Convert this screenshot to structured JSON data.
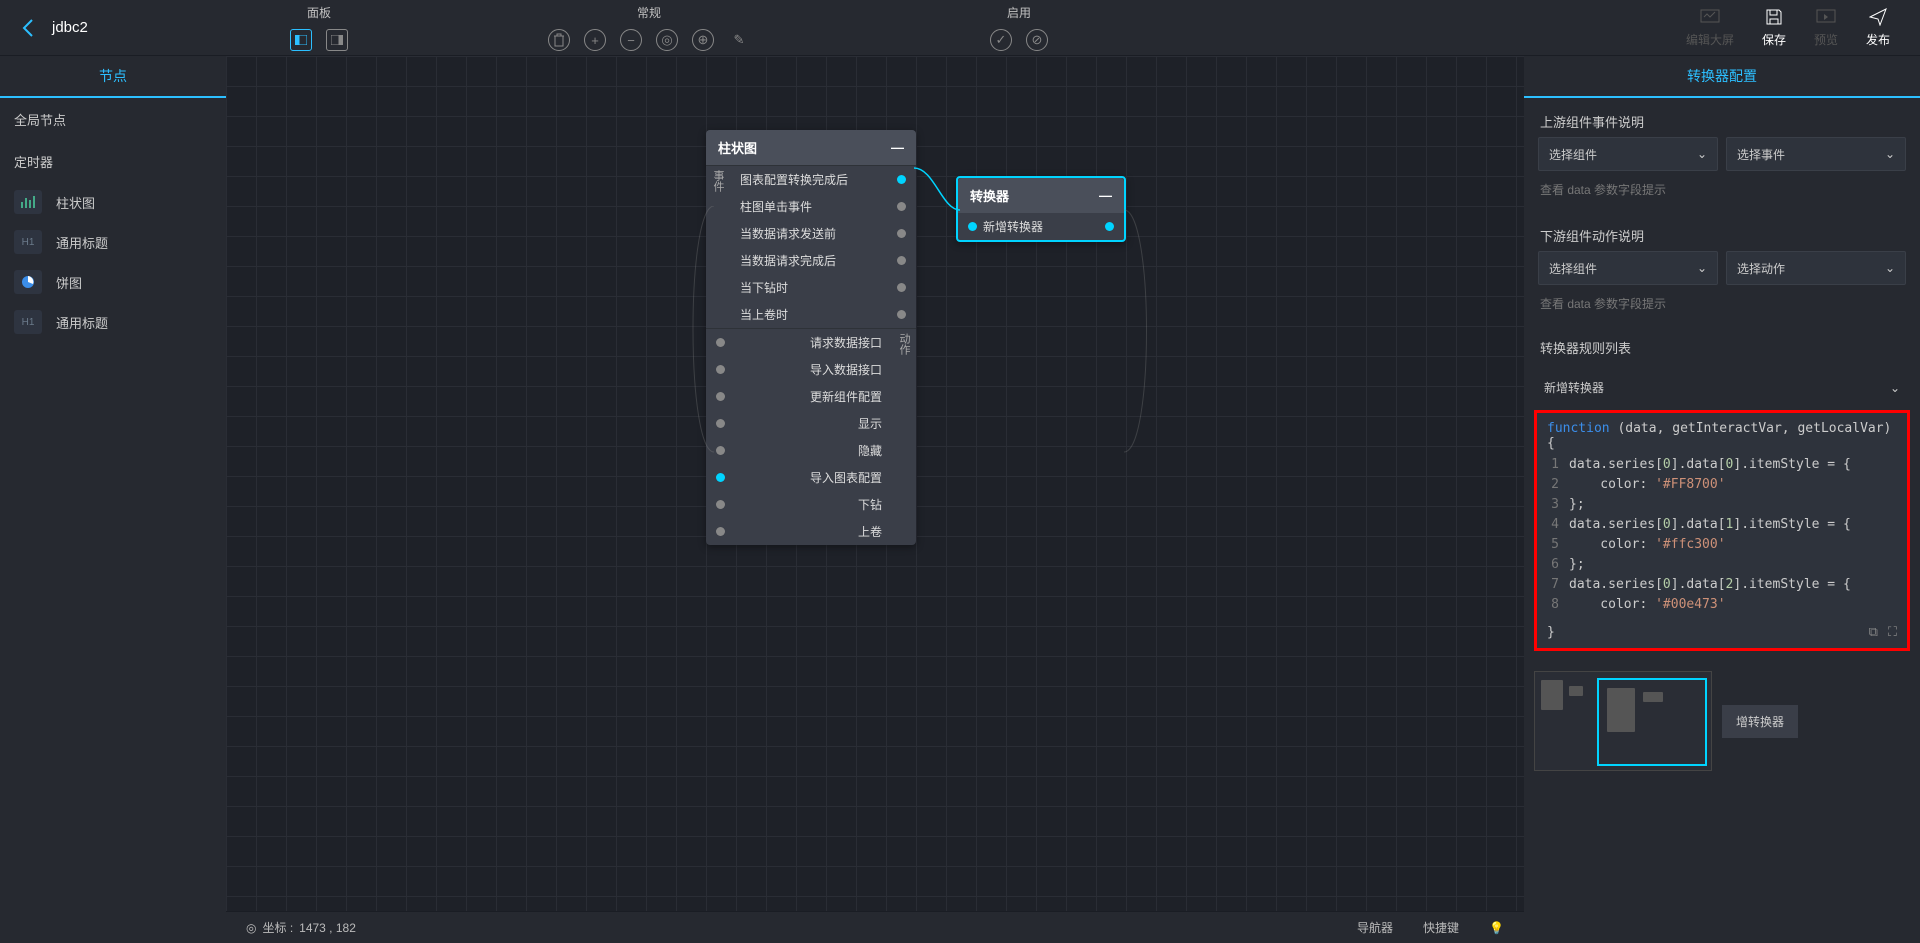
{
  "header": {
    "title": "jdbc2",
    "sections": {
      "panel": "面板",
      "routine": "常规",
      "enable": "启用"
    },
    "right_actions": {
      "edit_screen": "编辑大屏",
      "save": "保存",
      "preview": "预览",
      "publish": "发布"
    }
  },
  "sidebar_left": {
    "tab": "节点",
    "global_header": "全局节点",
    "timer_header": "定时器",
    "nodes": [
      {
        "label": "柱状图",
        "icon": "bar"
      },
      {
        "label": "通用标题",
        "icon": "h1"
      },
      {
        "label": "饼图",
        "icon": "pie"
      },
      {
        "label": "通用标题",
        "icon": "h1"
      }
    ]
  },
  "canvas": {
    "bar_node": {
      "title": "柱状图",
      "event_label": "事件",
      "action_label": "动作",
      "events": [
        {
          "label": "图表配置转换完成后",
          "active": true
        },
        {
          "label": "柱图单击事件",
          "active": false
        },
        {
          "label": "当数据请求发送前",
          "active": false
        },
        {
          "label": "当数据请求完成后",
          "active": false
        },
        {
          "label": "当下钻时",
          "active": false
        },
        {
          "label": "当上卷时",
          "active": false
        }
      ],
      "actions": [
        {
          "label": "请求数据接口",
          "active": false
        },
        {
          "label": "导入数据接口",
          "active": false
        },
        {
          "label": "更新组件配置",
          "active": false
        },
        {
          "label": "显示",
          "active": false
        },
        {
          "label": "隐藏",
          "active": false
        },
        {
          "label": "导入图表配置",
          "active": true
        },
        {
          "label": "下钻",
          "active": false
        },
        {
          "label": "上卷",
          "active": false
        }
      ]
    },
    "transformer_node": {
      "title": "转换器",
      "port_label": "新增转换器"
    }
  },
  "sidebar_right": {
    "tab": "转换器配置",
    "upstream_label": "上游组件事件说明",
    "downstream_label": "下游组件动作说明",
    "select_component": "选择组件",
    "select_event": "选择事件",
    "select_action": "选择动作",
    "hint": "查看 data 参数字段提示",
    "rule_list_header": "转换器规则列表",
    "rule_item": "新增转换器",
    "code": {
      "func_sig_prefix": "function",
      "func_sig_params": " (data, getInteractVar, getLocalVar) {",
      "lines": [
        "data.series[0].data[0].itemStyle = {",
        "    color: '#FF8700'",
        "};",
        "data.series[0].data[1].itemStyle = {",
        "    color: '#ffc300'",
        "};",
        "data.series[0].data[2].itemStyle = {",
        "    color: '#00e473'"
      ],
      "close": "}"
    },
    "minimap_label": "增转换器"
  },
  "status_bar": {
    "coords_label": "坐标 :",
    "coords_value": "1473 , 182",
    "navigator": "导航器",
    "shortcut": "快捷键"
  }
}
